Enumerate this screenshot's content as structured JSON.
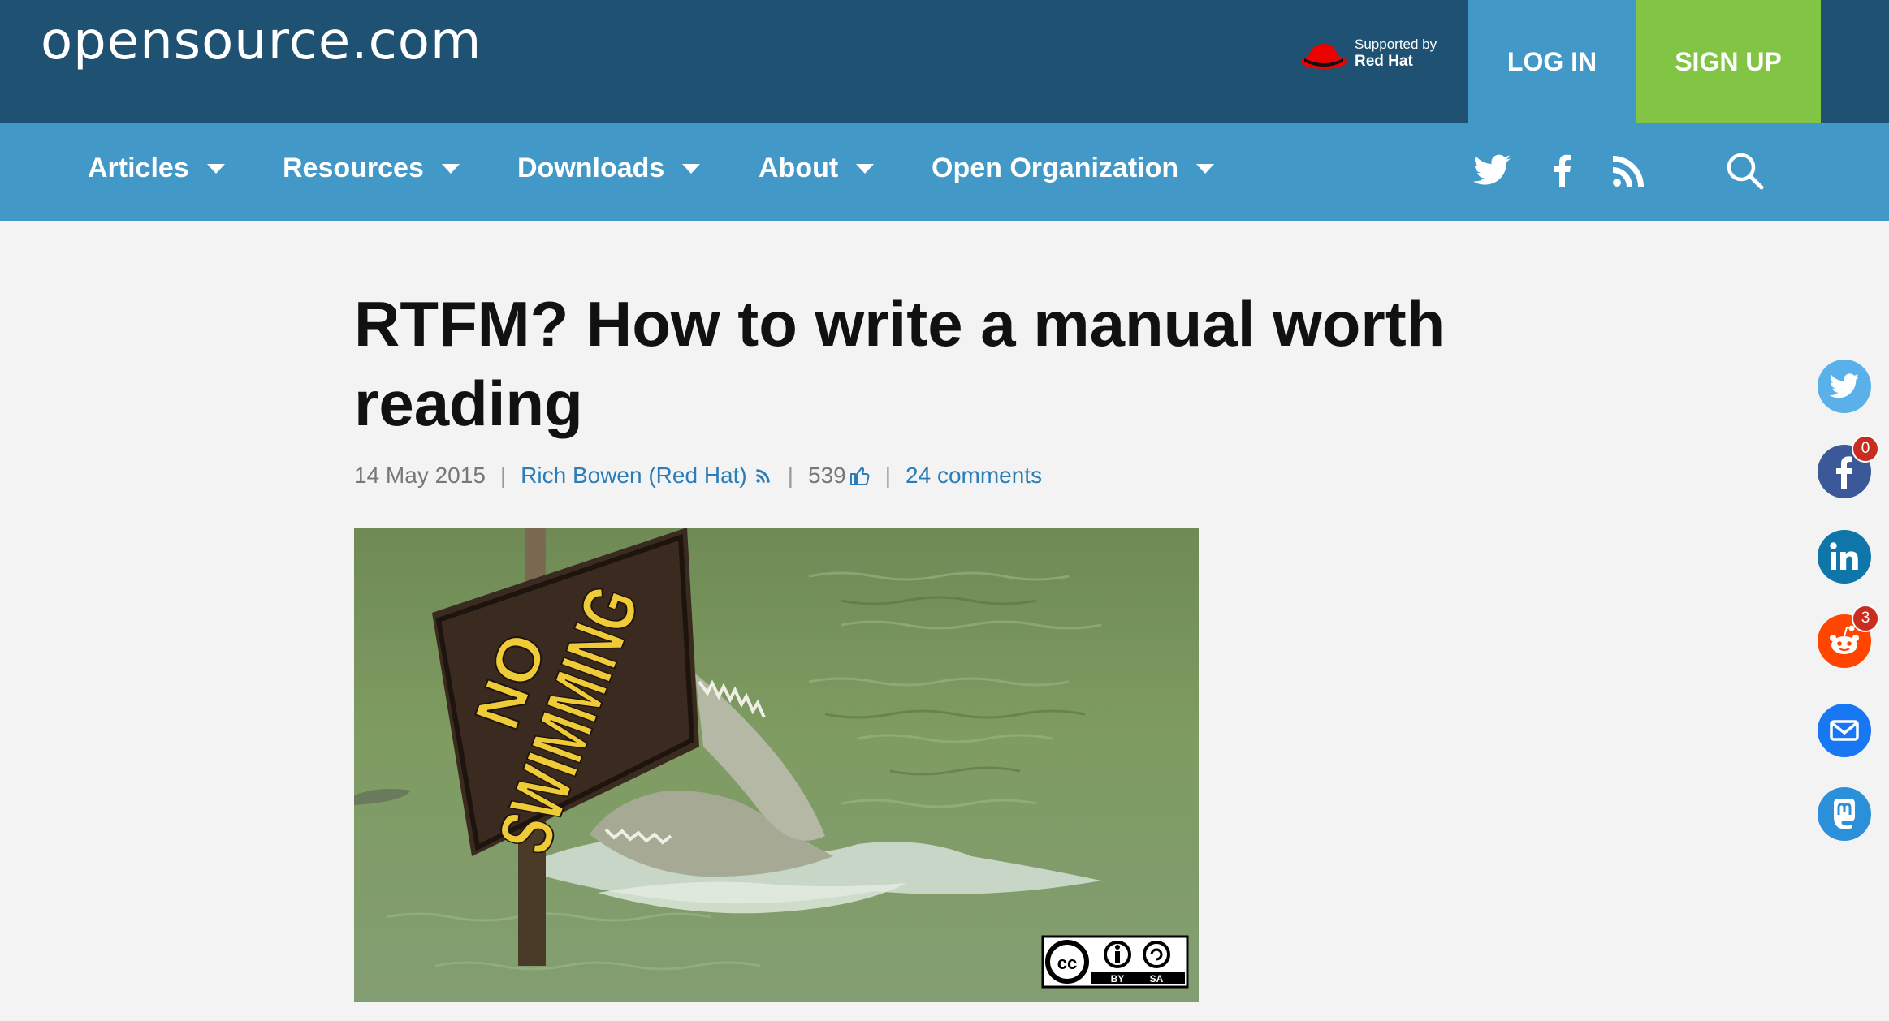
{
  "header": {
    "logo": "opensource.com",
    "sponsor_line1": "Supported by",
    "sponsor_line2": "Red Hat",
    "login_label": "LOG IN",
    "signup_label": "SIGN UP"
  },
  "nav": {
    "items": [
      {
        "label": "Articles"
      },
      {
        "label": "Resources"
      },
      {
        "label": "Downloads"
      },
      {
        "label": "About"
      },
      {
        "label": "Open Organization"
      }
    ],
    "icons": [
      "twitter-icon",
      "facebook-icon",
      "rss-icon",
      "search-icon"
    ]
  },
  "article": {
    "title": "RTFM? How to write a manual worth reading",
    "date": "14 May 2015",
    "author": "Rich Bowen (Red Hat)",
    "likes": "539",
    "comments": "24 comments",
    "image_sign_line1": "NO",
    "image_sign_line2": "SWIMMING",
    "license_by": "BY",
    "license_sa": "SA"
  },
  "share": {
    "facebook_count": "0",
    "reddit_count": "3",
    "buttons": [
      "twitter-share",
      "facebook-share",
      "linkedin-share",
      "reddit-share",
      "email-share",
      "mastodon-share"
    ]
  },
  "colors": {
    "topbar": "#1f5172",
    "navbar": "#4299c8",
    "signup": "#82c443",
    "link": "#2a7db8"
  }
}
